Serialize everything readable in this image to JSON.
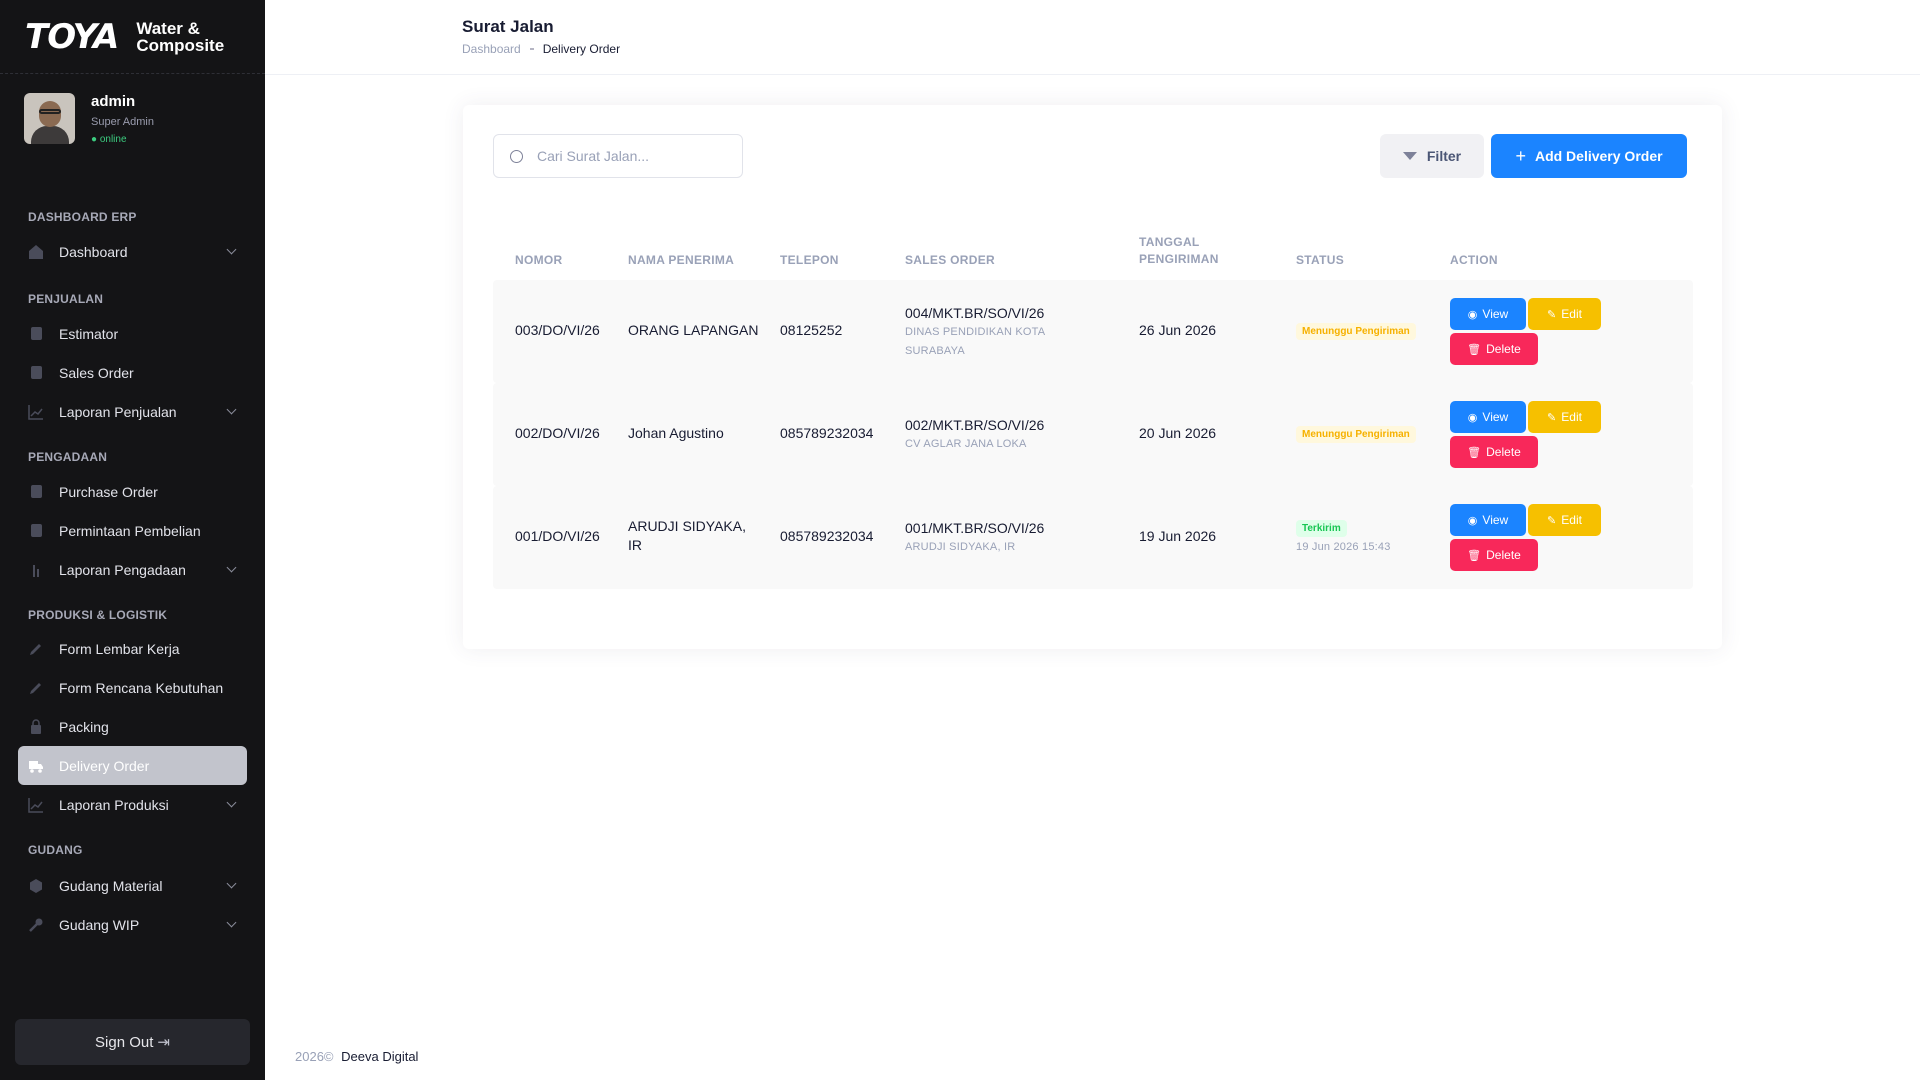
{
  "brand": {
    "logo": "TOYA",
    "sub_line1": "Water &",
    "sub_line2": "Composite"
  },
  "user": {
    "name": "admin",
    "role": "Super Admin",
    "status": "● online"
  },
  "sidebar": {
    "sections": [
      {
        "title": "DASHBOARD ERP",
        "items": [
          {
            "label": "Dashboard",
            "icon": "home-icon",
            "chevron": true
          }
        ]
      },
      {
        "title": "PENJUALAN",
        "items": [
          {
            "label": "Estimator",
            "icon": "document-icon"
          },
          {
            "label": "Sales Order",
            "icon": "document-icon"
          },
          {
            "label": "Laporan Penjualan",
            "icon": "chart-line-icon",
            "chevron": true
          }
        ]
      },
      {
        "title": "PENGADAAN",
        "items": [
          {
            "label": "Purchase Order",
            "icon": "document-icon"
          },
          {
            "label": "Permintaan Pembelian",
            "icon": "document-icon"
          },
          {
            "label": "Laporan Pengadaan",
            "icon": "chart-bar-icon",
            "chevron": true
          }
        ]
      },
      {
        "title": "PRODUKSI & LOGISTIK",
        "items": [
          {
            "label": "Form Lembar Kerja",
            "icon": "pen-icon"
          },
          {
            "label": "Form Rencana Kebutuhan",
            "icon": "pen-icon"
          },
          {
            "label": "Packing",
            "icon": "package-icon"
          },
          {
            "label": "Delivery Order",
            "icon": "truck-icon",
            "active": true
          },
          {
            "label": "Laporan Produksi",
            "icon": "chart-line-icon",
            "chevron": true
          }
        ]
      },
      {
        "title": "GUDANG",
        "items": [
          {
            "label": "Gudang Material",
            "icon": "cube-icon",
            "chevron": true
          },
          {
            "label": "Gudang WIP",
            "icon": "wrench-icon",
            "chevron": true
          }
        ]
      }
    ],
    "signout_label": "Sign Out"
  },
  "header": {
    "title": "Surat Jalan",
    "breadcrumb_root": "Dashboard",
    "breadcrumb_current": "Delivery Order"
  },
  "toolbar": {
    "search_placeholder": "Cari Surat Jalan...",
    "filter_label": "Filter",
    "add_label": "Add Delivery Order"
  },
  "table": {
    "headers": {
      "nomor": "NOMOR",
      "nama": "NAMA PENERIMA",
      "telepon": "TELEPON",
      "sales_order": "SALES ORDER",
      "tanggal_1": "TANGGAL",
      "tanggal_2": "PENGIRIMAN",
      "status": "STATUS",
      "action": "ACTION"
    },
    "action_labels": {
      "view": "View",
      "edit": "Edit",
      "delete": "Delete"
    },
    "rows": [
      {
        "nomor": "003/DO/VI/26",
        "nama_1": "ORANG LAPANGAN",
        "nama_2": "",
        "telepon": "08125252",
        "so": "004/MKT.BR/SO/VI/26",
        "so_sub_1": "DINAS PENDIDIKAN KOTA",
        "so_sub_2": "SURABAYA",
        "tanggal": "26 Jun 2026",
        "status": "Menunggu Pengiriman",
        "status_type": "wait",
        "status_time": ""
      },
      {
        "nomor": "002/DO/VI/26",
        "nama_1": "Johan Agustino",
        "nama_2": "",
        "telepon": "085789232034",
        "so": "002/MKT.BR/SO/VI/26",
        "so_sub_1": "CV AGLAR JANA LOKA",
        "so_sub_2": "",
        "tanggal": "20 Jun 2026",
        "status": "Menunggu Pengiriman",
        "status_type": "wait",
        "status_time": ""
      },
      {
        "nomor": "001/DO/VI/26",
        "nama_1": "ARUDJI SIDYAKA,",
        "nama_2": "IR",
        "telepon": "085789232034",
        "so": "001/MKT.BR/SO/VI/26",
        "so_sub_1": "ARUDJI SIDYAKA, IR",
        "so_sub_2": "",
        "tanggal": "19 Jun 2026",
        "status": "Terkirim",
        "status_type": "sent",
        "status_time": "19 Jun 2026 15:43"
      }
    ]
  },
  "footer": {
    "year": "2026©",
    "company": "Deeva Digital"
  },
  "colors": {
    "primary": "#1b84ff",
    "warning": "#f6c000",
    "danger": "#f8285a",
    "success": "#17c653",
    "sidebar_bg": "#141416"
  }
}
